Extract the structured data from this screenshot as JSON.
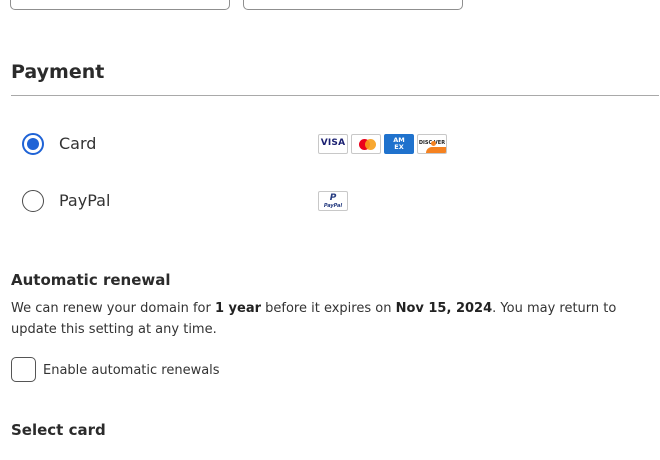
{
  "payment": {
    "title": "Payment",
    "options": [
      {
        "label": "Card",
        "selected": true,
        "logos": [
          "visa-logo",
          "mastercard-logo",
          "amex-logo",
          "discover-logo"
        ]
      },
      {
        "label": "PayPal",
        "selected": false,
        "logos": [
          "paypal-logo"
        ]
      }
    ],
    "logo_text": {
      "visa": "VISA",
      "amex_line1": "AM",
      "amex_line2": "EX",
      "discover": "DISC  VER",
      "paypal_mark": "P",
      "paypal": "PayPal"
    }
  },
  "renewal": {
    "title": "Automatic renewal",
    "text_before": "We can renew your domain for ",
    "duration": "1 year",
    "text_middle": " before it expires on ",
    "expiry_date": "Nov 15, 2024",
    "text_after": ". You may return to update this setting at any time.",
    "checkbox_label": "Enable automatic renewals",
    "checkbox_checked": false
  },
  "select_card": {
    "title": "Select card"
  },
  "colors": {
    "accent": "#1f63d6",
    "divider": "#a9a9a9"
  }
}
